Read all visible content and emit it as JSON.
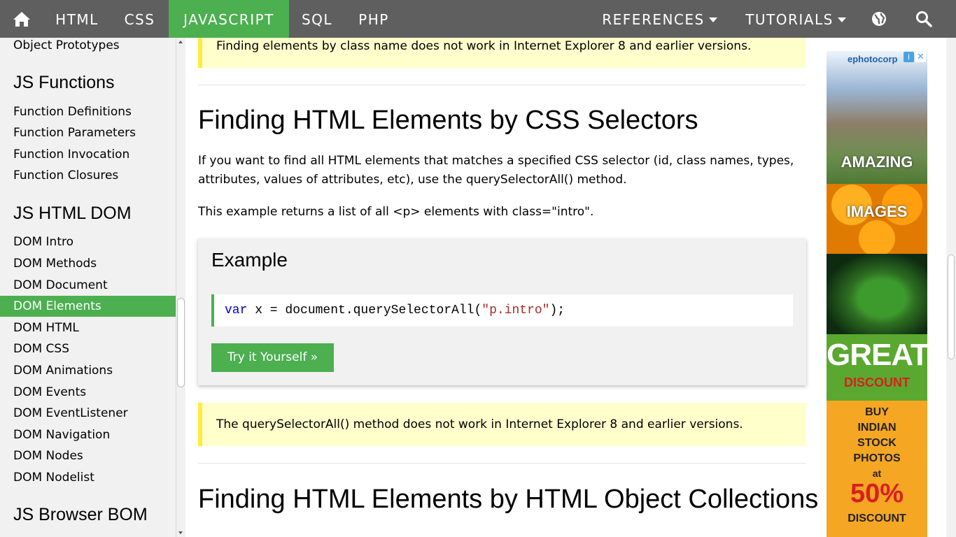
{
  "nav": {
    "items": [
      "HTML",
      "CSS",
      "JAVASCRIPT",
      "SQL",
      "PHP"
    ],
    "active": "JAVASCRIPT",
    "references_label": "REFERENCES",
    "tutorials_label": "TUTORIALS",
    "icons": [
      "home-icon",
      "globe-icon",
      "search-icon"
    ],
    "active_color": "#4caf50",
    "bar_color": "#5f5f5f"
  },
  "sidebar": {
    "top_item": "Object Prototypes",
    "functions_heading": "JS Functions",
    "functions_items": [
      "Function Definitions",
      "Function Parameters",
      "Function Invocation",
      "Function Closures"
    ],
    "dom_heading": "JS HTML DOM",
    "dom_items": [
      "DOM Intro",
      "DOM Methods",
      "DOM Document",
      "DOM Elements",
      "DOM HTML",
      "DOM CSS",
      "DOM Animations",
      "DOM Events",
      "DOM EventListener",
      "DOM Navigation",
      "DOM Nodes",
      "DOM Nodelist"
    ],
    "dom_active": "DOM Elements",
    "bom_heading": "JS Browser BOM"
  },
  "main": {
    "note_top": "Finding elements by class name does not work in Internet Explorer 8 and earlier versions.",
    "heading_selectors": "Finding HTML Elements by CSS Selectors",
    "para1": "If you want to find all HTML elements that matches a specified CSS selector (id, class names, types, attributes, values of attributes, etc), use the querySelectorAll() method.",
    "para2": "This example returns a list of all <p> elements with class=\"intro\".",
    "example": {
      "title": "Example",
      "code_keyword": "var",
      "code_mid": " x = document.querySelectorAll(",
      "code_string": "\"p.intro\"",
      "code_end": ");",
      "button_label": "Try it Yourself »"
    },
    "note_bottom": "The querySelectorAll() method does not work in Internet Explorer 8 and earlier versions.",
    "heading_collections": "Finding HTML Elements by HTML Object Collections"
  },
  "ad": {
    "brand": "ephotocorp",
    "word1": "AMAZING",
    "word2": "IMAGES",
    "great": "GREAT",
    "discount": "DISCOUNT",
    "buy_lines": [
      "BUY",
      "INDIAN",
      "STOCK",
      "PHOTOS",
      "at"
    ],
    "percent": "50%",
    "discount2": "DISCOUNT"
  }
}
